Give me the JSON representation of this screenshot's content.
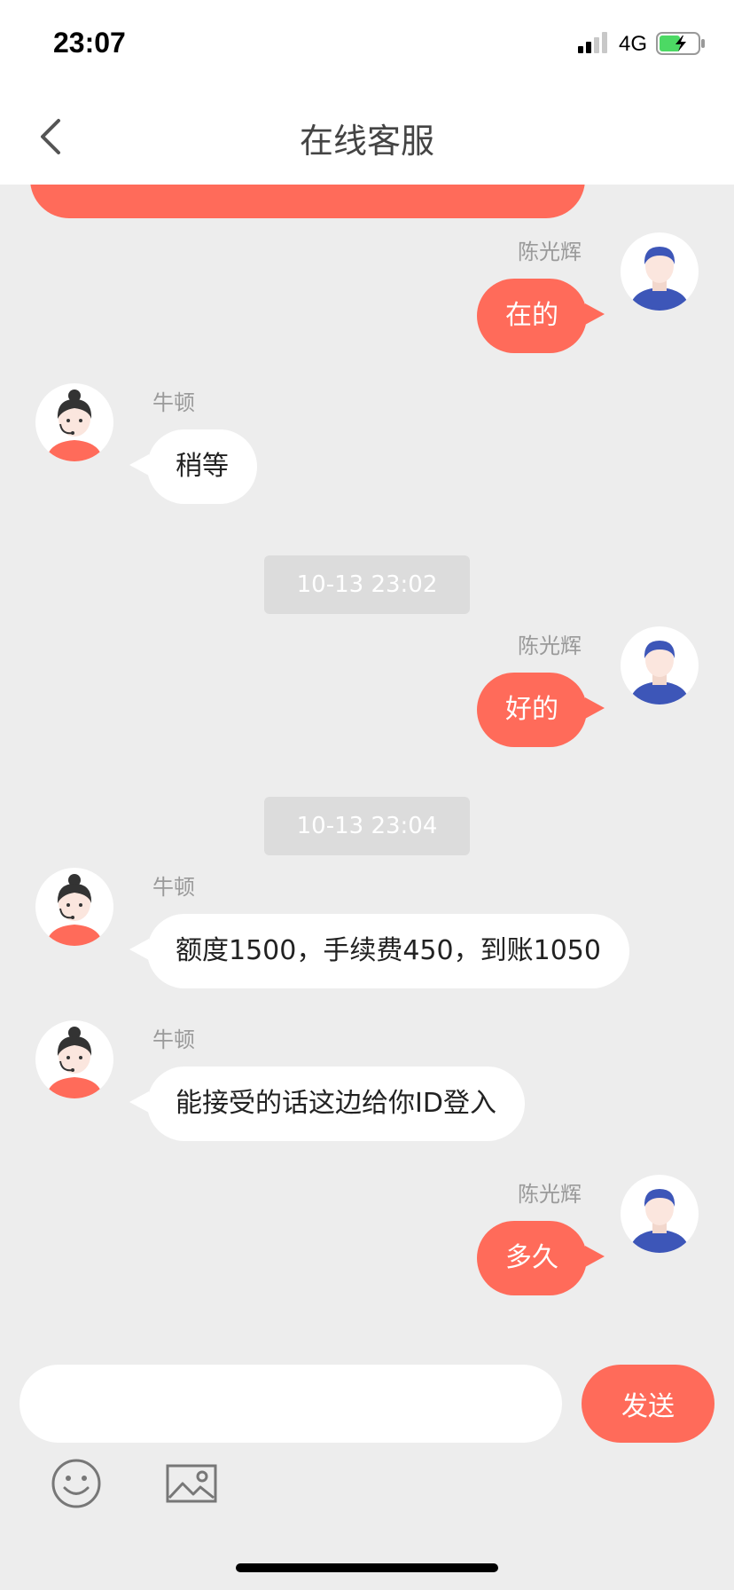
{
  "status_bar": {
    "time": "23:07",
    "network": "4G",
    "battery_level": 0.55,
    "battery_color": "#4cd964"
  },
  "header": {
    "title": "在线客服",
    "back_icon": "chevron-left-icon"
  },
  "colors": {
    "accent": "#ff6b5a",
    "background": "#ededed",
    "timestamp_bg": "#dcdcdc"
  },
  "messages": [
    {
      "side": "right",
      "sender": "陈光辉",
      "text": "在的"
    },
    {
      "side": "left",
      "sender": "牛顿",
      "text": "稍等"
    },
    {
      "type": "time",
      "text": "10-13 23:02"
    },
    {
      "side": "right",
      "sender": "陈光辉",
      "text": "好的"
    },
    {
      "type": "time",
      "text": "10-13 23:04"
    },
    {
      "side": "left",
      "sender": "牛顿",
      "text": "额度1500，手续费450，到账1050"
    },
    {
      "side": "left",
      "sender": "牛顿",
      "text": "能接受的话这边给你ID登入"
    },
    {
      "side": "right",
      "sender": "陈光辉",
      "text": "多久"
    }
  ],
  "composer": {
    "input_value": "",
    "placeholder": "",
    "send_label": "发送",
    "tools": [
      "emoji-icon",
      "image-icon"
    ]
  }
}
